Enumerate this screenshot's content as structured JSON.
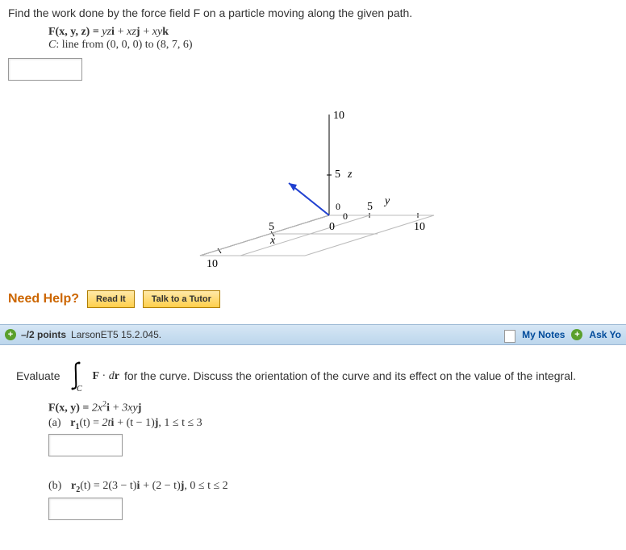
{
  "q1": {
    "stem": "Find the work done by the force field F on a particle moving along the given path.",
    "force_lhs": "F(x, y, z) = ",
    "force_rhs_yz": "yz",
    "force_rhs_xz": "xz",
    "force_rhs_xy": "xy",
    "i": "i",
    "j": "j",
    "k": "k",
    "plus": " + ",
    "path": "C: line from (0, 0, 0) to (8, 7, 6)"
  },
  "graph": {
    "z_top": "10",
    "z_mid": "5",
    "z_label": "z",
    "origin0a": "0",
    "origin0b": "0",
    "origin0c": "0",
    "y_mid": "5",
    "y_far": "10",
    "y_label": "y",
    "x_mid": "5",
    "x_far": "10",
    "x_label": "x"
  },
  "help": {
    "label": "Need Help?",
    "read": "Read It",
    "tutor": "Talk to a Tutor"
  },
  "bar": {
    "points": "–/2 points",
    "ref": "LarsonET5 15.2.045.",
    "mynotes": "My Notes",
    "ask": "Ask Yo"
  },
  "q2": {
    "eval": "Evaluate",
    "F": "F",
    "dot": " · ",
    "dr": "dr",
    "rest": " for the curve. Discuss the orientation of the curve and its effect on the value of the integral.",
    "int_sub": "C",
    "force_lhs": "F(x, y) = ",
    "fx": "2x",
    "fx_exp": "2",
    "fy": "3xy",
    "a_label": "(a)",
    "r1_lhs": "r",
    "r1_sub": "1",
    "r1_paren": "(t) = ",
    "r1_x": "2t",
    "r1_y": "(t − 1)",
    "a_bounds": "1 ≤ t ≤ 3",
    "b_label": "(b)",
    "r2_sub": "2",
    "r2_x": "2(3 − t)",
    "r2_y": "(2 − t)",
    "b_bounds": "0 ≤ t ≤ 2",
    "comma": ",   "
  }
}
